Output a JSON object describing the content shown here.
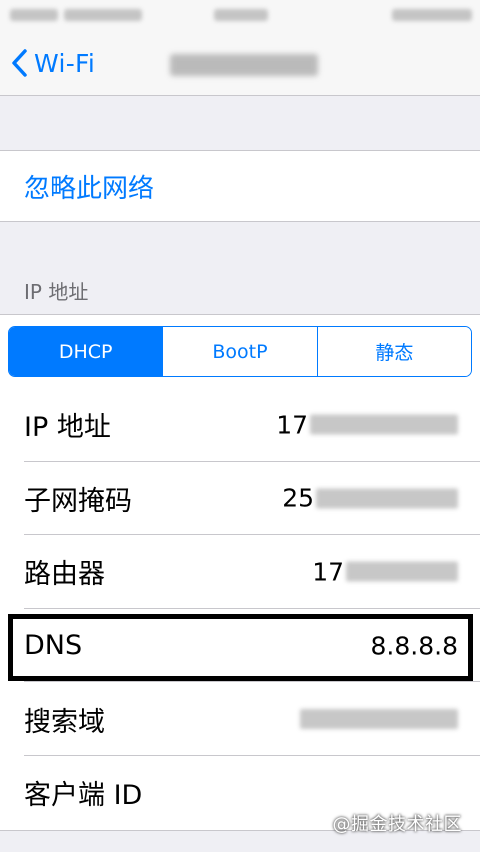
{
  "nav": {
    "back_label": "Wi-Fi"
  },
  "forget_network": "忽略此网络",
  "ip_section_header": "IP 地址",
  "segmented": {
    "options": [
      "DHCP",
      "BootP",
      "静态"
    ],
    "selected": "DHCP"
  },
  "rows": [
    {
      "label": "IP 地址",
      "value": "17"
    },
    {
      "label": "子网掩码",
      "value": "25"
    },
    {
      "label": "路由器",
      "value": "17"
    },
    {
      "label": "DNS",
      "value": "8.8.8.8"
    },
    {
      "label": "搜索域",
      "value": ""
    },
    {
      "label": "客户端 ID",
      "value": ""
    }
  ],
  "watermark": "@掘金技术社区",
  "colors": {
    "accent": "#007aff",
    "background": "#efeff4"
  }
}
